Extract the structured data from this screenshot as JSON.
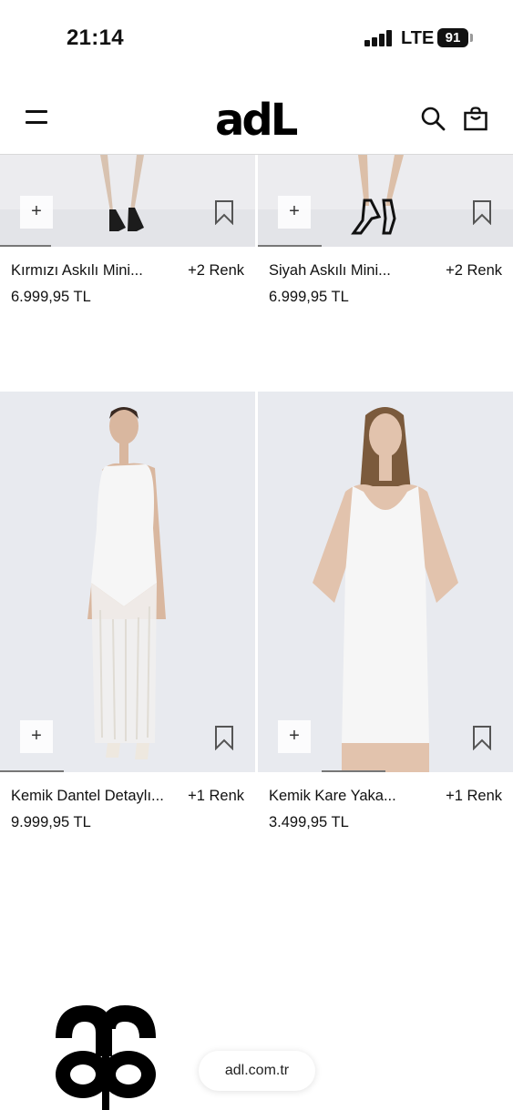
{
  "status_bar": {
    "time": "21:14",
    "network": "LTE",
    "battery": "91"
  },
  "header": {
    "brand": "adL",
    "menu_icon": "hamburger-menu-icon",
    "search_icon": "search-icon",
    "cart_icon": "shopping-bag-icon"
  },
  "products": [
    {
      "name": "Kırmızı Askılı Mini...",
      "colors": "+2 Renk",
      "price": "6.999,95 TL",
      "quick_add": "+"
    },
    {
      "name": "Siyah Askılı Mini...",
      "colors": "+2 Renk",
      "price": "6.999,95 TL",
      "quick_add": "+"
    },
    {
      "name": "Kemik Dantel Detaylı...",
      "colors": "+1 Renk",
      "price": "9.999,95 TL",
      "quick_add": "+"
    },
    {
      "name": "Kemik Kare Yaka...",
      "colors": "+1 Renk",
      "price": "3.499,95 TL",
      "quick_add": "+"
    }
  ],
  "browser": {
    "url": "adl.com.tr"
  },
  "colors": {
    "image_bg": "#e9eaee",
    "text": "#111111"
  }
}
